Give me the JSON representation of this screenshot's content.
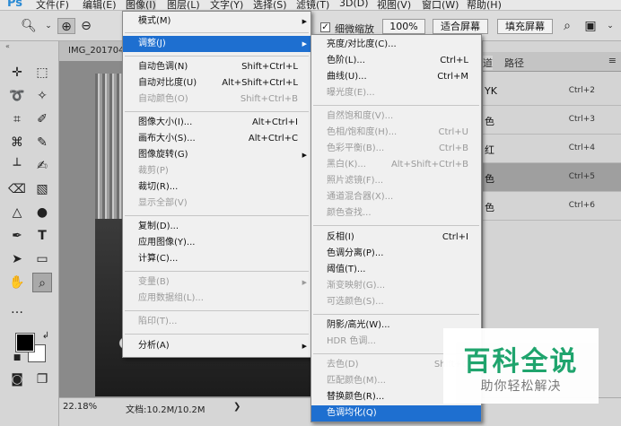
{
  "app": {
    "logo": "Ps"
  },
  "menubar": {
    "items": [
      "文件(F)",
      "编辑(E)",
      "图像(I)",
      "图层(L)",
      "文字(Y)",
      "选择(S)",
      "滤镜(T)",
      "3D(D)",
      "视图(V)",
      "窗口(W)",
      "帮助(H)"
    ]
  },
  "options_bar": {
    "fine_zoom_label": "细微缩放",
    "zoom_value": "100%",
    "fit_screen": "适合屏幕",
    "fill_screen": "填充屏幕"
  },
  "document": {
    "tab_title": "IMG_201704"
  },
  "status": {
    "zoom": "22.18%",
    "doc_size": "文档:10.2M/10.2M"
  },
  "channels_panel": {
    "tabs": [
      "道",
      "路径"
    ],
    "rows": [
      {
        "name": "YK",
        "shortcut": "Ctrl+2"
      },
      {
        "name": "色",
        "shortcut": "Ctrl+3"
      },
      {
        "name": "红",
        "shortcut": "Ctrl+4"
      },
      {
        "name": "色",
        "shortcut": "Ctrl+5"
      },
      {
        "name": "色",
        "shortcut": "Ctrl+6"
      }
    ]
  },
  "image_menu": {
    "items": [
      {
        "label": "模式(M)",
        "shortcut": "",
        "submenu": true,
        "disabled": false
      },
      {
        "label": "调整(J)",
        "shortcut": "",
        "submenu": true,
        "disabled": false,
        "highlighted": true
      },
      {
        "label": "自动色调(N)",
        "shortcut": "Shift+Ctrl+L",
        "disabled": false
      },
      {
        "label": "自动对比度(U)",
        "shortcut": "Alt+Shift+Ctrl+L",
        "disabled": false
      },
      {
        "label": "自动颜色(O)",
        "shortcut": "Shift+Ctrl+B",
        "disabled": true
      },
      {
        "label": "图像大小(I)...",
        "shortcut": "Alt+Ctrl+I",
        "disabled": false
      },
      {
        "label": "画布大小(S)...",
        "shortcut": "Alt+Ctrl+C",
        "disabled": false
      },
      {
        "label": "图像旋转(G)",
        "shortcut": "",
        "submenu": true,
        "disabled": false
      },
      {
        "label": "裁剪(P)",
        "shortcut": "",
        "disabled": true
      },
      {
        "label": "裁切(R)...",
        "shortcut": "",
        "disabled": false
      },
      {
        "label": "显示全部(V)",
        "shortcut": "",
        "disabled": true
      },
      {
        "label": "复制(D)...",
        "shortcut": "",
        "disabled": false
      },
      {
        "label": "应用图像(Y)...",
        "shortcut": "",
        "disabled": false
      },
      {
        "label": "计算(C)...",
        "shortcut": "",
        "disabled": false
      },
      {
        "label": "变量(B)",
        "shortcut": "",
        "submenu": true,
        "disabled": true
      },
      {
        "label": "应用数据组(L)...",
        "shortcut": "",
        "disabled": true
      },
      {
        "label": "陷印(T)...",
        "shortcut": "",
        "disabled": true
      },
      {
        "label": "分析(A)",
        "shortcut": "",
        "submenu": true,
        "disabled": false
      }
    ]
  },
  "adjust_menu": {
    "items": [
      {
        "label": "亮度/对比度(C)...",
        "shortcut": "",
        "disabled": false
      },
      {
        "label": "色阶(L)...",
        "shortcut": "Ctrl+L",
        "disabled": false
      },
      {
        "label": "曲线(U)...",
        "shortcut": "Ctrl+M",
        "disabled": false
      },
      {
        "label": "曝光度(E)...",
        "shortcut": "",
        "disabled": true
      },
      {
        "label": "自然饱和度(V)...",
        "shortcut": "",
        "disabled": true
      },
      {
        "label": "色相/饱和度(H)...",
        "shortcut": "Ctrl+U",
        "disabled": true
      },
      {
        "label": "色彩平衡(B)...",
        "shortcut": "Ctrl+B",
        "disabled": true
      },
      {
        "label": "黑白(K)...",
        "shortcut": "Alt+Shift+Ctrl+B",
        "disabled": true
      },
      {
        "label": "照片滤镜(F)...",
        "shortcut": "",
        "disabled": true
      },
      {
        "label": "通道混合器(X)...",
        "shortcut": "",
        "disabled": true
      },
      {
        "label": "颜色查找...",
        "shortcut": "",
        "disabled": true
      },
      {
        "label": "反相(I)",
        "shortcut": "Ctrl+I",
        "disabled": false
      },
      {
        "label": "色调分离(P)...",
        "shortcut": "",
        "disabled": false
      },
      {
        "label": "阈值(T)...",
        "shortcut": "",
        "disabled": false
      },
      {
        "label": "渐变映射(G)...",
        "shortcut": "",
        "disabled": true
      },
      {
        "label": "可选颜色(S)...",
        "shortcut": "",
        "disabled": true
      },
      {
        "label": "阴影/高光(W)...",
        "shortcut": "",
        "disabled": false
      },
      {
        "label": "HDR 色调...",
        "shortcut": "",
        "disabled": true
      },
      {
        "label": "去色(D)",
        "shortcut": "Shift+C",
        "disabled": true
      },
      {
        "label": "匹配颜色(M)...",
        "shortcut": "",
        "disabled": true
      },
      {
        "label": "替换颜色(R)...",
        "shortcut": "",
        "disabled": false
      },
      {
        "label": "色调均化(Q)",
        "shortcut": "",
        "disabled": false,
        "highlighted": true
      }
    ]
  },
  "watermark": {
    "title": "百科全说",
    "subtitle": "助你轻松解决"
  },
  "colors": {
    "menu_highlight": "#1e6fd0",
    "watermark_green": "#1aa36a",
    "ps_blue": "#2a8ad4"
  }
}
